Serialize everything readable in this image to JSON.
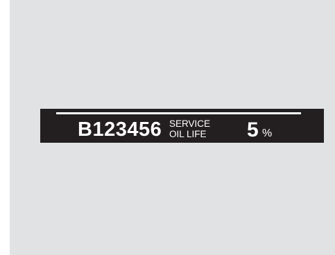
{
  "display": {
    "maintenance_code": "B123456",
    "label_line1": "SERVICE",
    "label_line2": "OIL LIFE",
    "oil_life_value": "5",
    "oil_life_unit": "%"
  },
  "colors": {
    "background": "#e1e2e4",
    "display_background": "#231f20",
    "text": "#ffffff"
  }
}
